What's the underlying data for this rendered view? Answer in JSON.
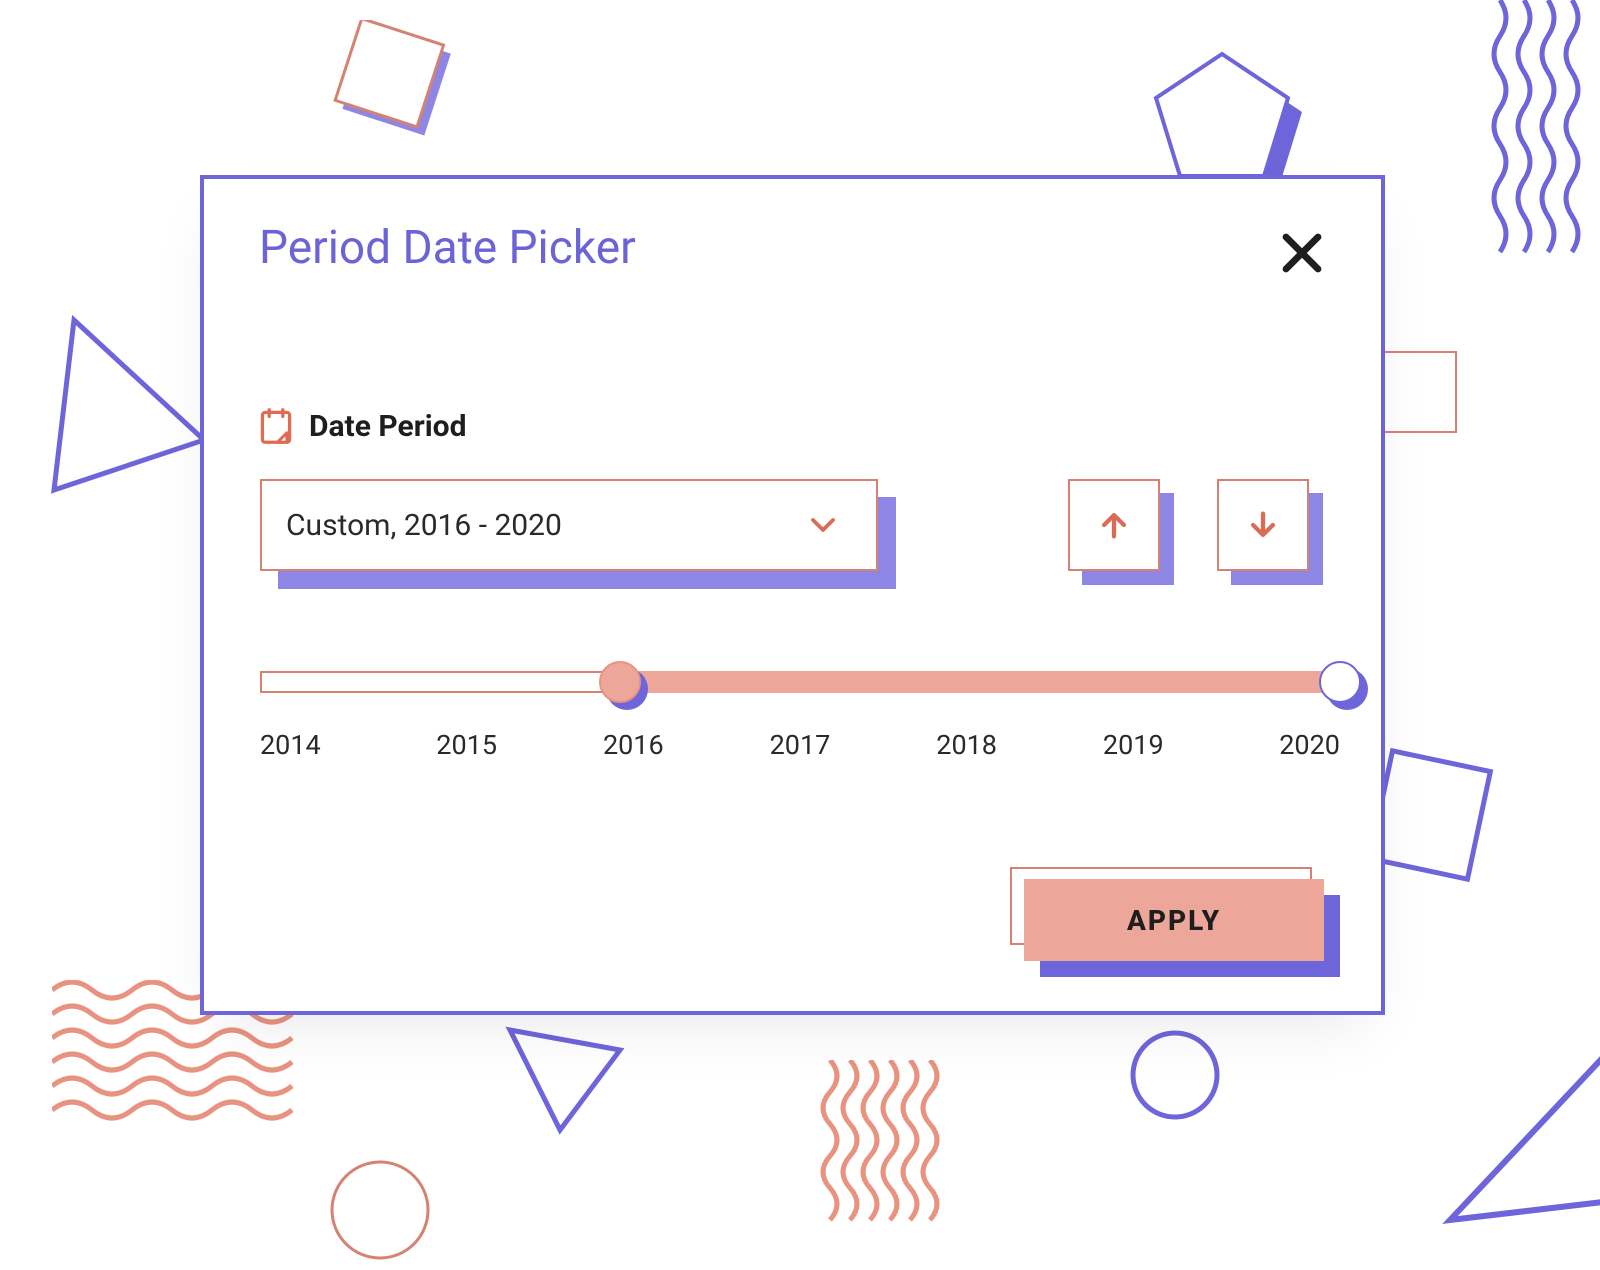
{
  "colors": {
    "purple": "#6f65db",
    "coral_line": "#d58273",
    "coral_fill": "#eda79a"
  },
  "dialog": {
    "title": "Period Date Picker",
    "section_label": "Date Period",
    "dropdown": {
      "selected": "Custom, 2016 - 2020"
    },
    "slider": {
      "min": 2014,
      "max": 2020,
      "start": 2016,
      "end": 2020,
      "ticks": [
        "2014",
        "2015",
        "2016",
        "2017",
        "2018",
        "2019",
        "2020"
      ]
    },
    "apply_label": "APPLY"
  }
}
